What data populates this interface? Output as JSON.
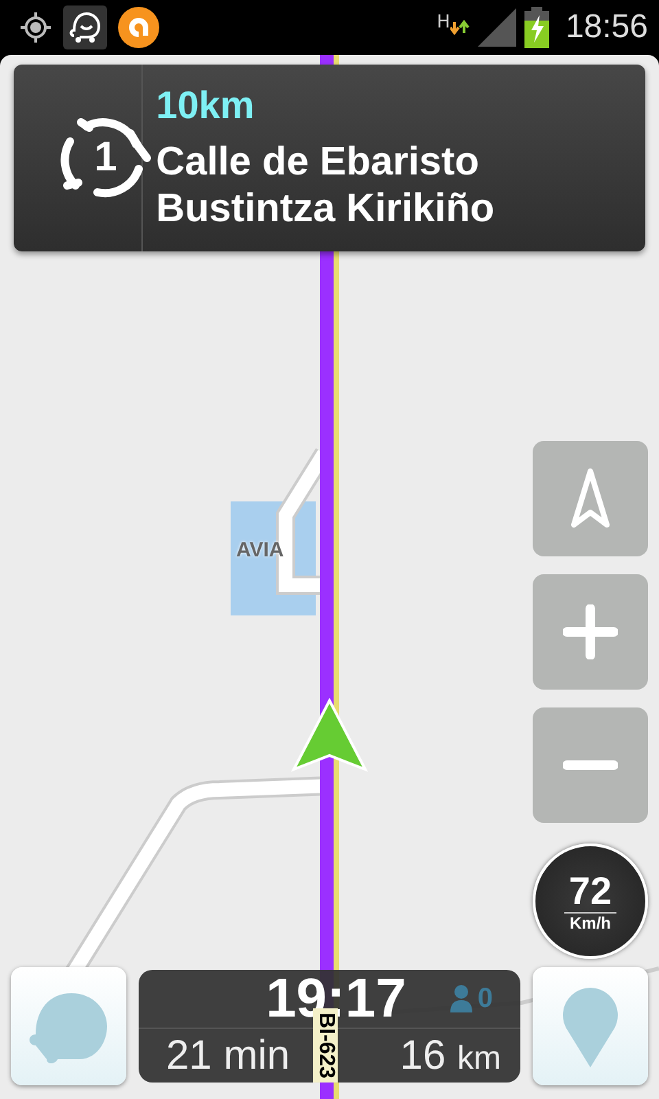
{
  "status_bar": {
    "network_type": "H",
    "time": "18:56"
  },
  "instruction": {
    "exit_number": "1",
    "distance": "10km",
    "street": "Calle de Ebaristo Bustintza Kirikiño"
  },
  "map": {
    "place_label": "AVIA",
    "road_label": "BI-623"
  },
  "speed": {
    "value": "72",
    "unit": "Km/h"
  },
  "trip": {
    "eta": "19:17",
    "riders": "0",
    "duration_value": "21",
    "duration_unit": "min",
    "distance_value": "16",
    "distance_unit": "km"
  }
}
